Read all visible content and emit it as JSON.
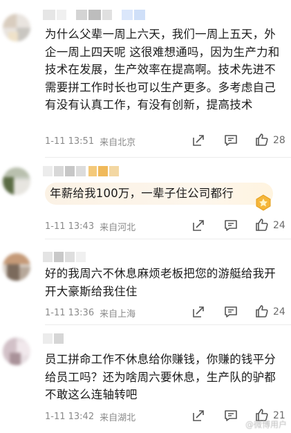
{
  "comments": [
    {
      "text": "为什么父辈一周上六天，我们一周上五天，外企一周上四天呢 这很难想通吗，因为生产力和技术在发展，生产效率在提高啊。技术先进不需要拼工作时长也可以生产更多。多考虑自己有没有认真工作，有没有创新，提高技术",
      "time": "1-11 13:51",
      "location": "来自北京",
      "likes": "28"
    },
    {
      "text": "年薪给我100万，一辈子住公司都行",
      "time": "1-11 13:43",
      "location": "来自河北",
      "likes": "24"
    },
    {
      "text": "好的我周六不休息麻烦老板把您的游艇给我开开大豪斯给我住住",
      "time": "1-11 13:36",
      "location": "来自上海",
      "likes": "24"
    },
    {
      "text": "员工拼命工作不休息给你赚钱，你赚的钱平分给员工吗？还为啥周六要休息，生产队的驴都不敢这么连轴转吧",
      "time": "1-11 13:42",
      "location": "来自湖北",
      "likes": "21"
    }
  ],
  "icons": {
    "share": "share-icon",
    "comment": "comment-icon",
    "like": "thumbs-up-icon",
    "badge": "fan-badge-icon"
  },
  "watermark": "@微博用户"
}
